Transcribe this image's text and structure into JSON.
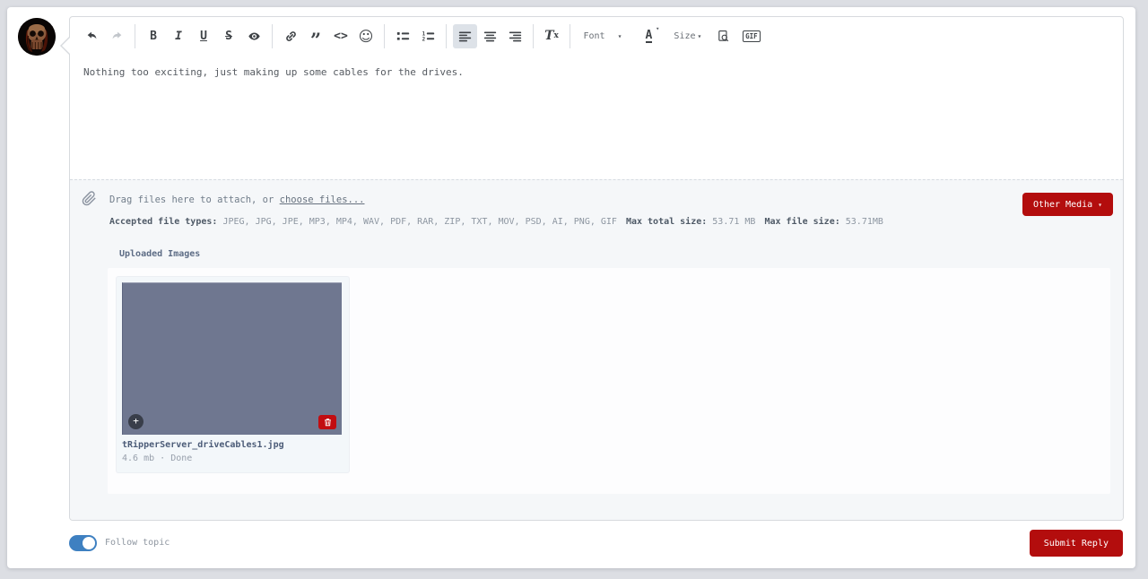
{
  "colors": {
    "accent_red": "#b30d0d",
    "toggle_blue": "#3e80c1",
    "thumbnail_slate": "#6f7790"
  },
  "icons": {
    "caret": "▾",
    "quote": "”",
    "smiley": "☺",
    "middot": "·",
    "plus": "+"
  },
  "toolbar": {
    "bold": "B",
    "italic": "I",
    "underline": "U",
    "strike": "S",
    "code": "<>",
    "clear_t": "T",
    "clear_x": "x",
    "font_label": "Font",
    "color_label": "A",
    "size_label": "Size",
    "gif_label": "GIF"
  },
  "editor": {
    "content": "Nothing too exciting, just making up some cables for the drives."
  },
  "attachments": {
    "drag_text": "Drag files here to attach, or ",
    "choose_link": "choose files...",
    "accepted_label": "Accepted file types:",
    "accepted_types": " JPEG, JPG, JPE, MP3, MP4, WAV, PDF, RAR, ZIP, TXT, MOV, PSD, AI, PNG, GIF",
    "max_total_label": "Max total size:",
    "max_total_value": " 53.71 MB",
    "max_file_label": "Max file size:",
    "max_file_value": " 53.71MB",
    "other_media_label": "Other Media",
    "uploaded_heading": "Uploaded Images",
    "file": {
      "name": "tRipperServer_driveCables1.jpg",
      "size": "4.6 mb",
      "status": "Done"
    }
  },
  "footer": {
    "follow_label": "Follow topic",
    "submit_label": "Submit Reply"
  }
}
